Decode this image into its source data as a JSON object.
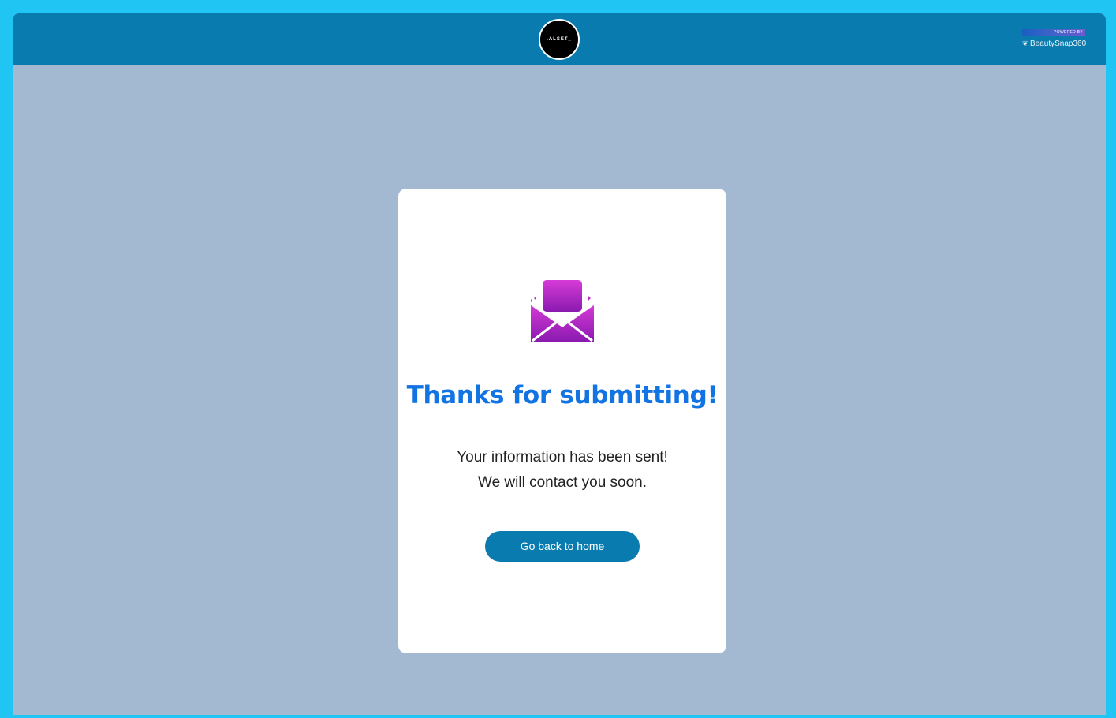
{
  "header": {
    "logo_text": ".ALSET_",
    "powered_by_label": "POWERED BY",
    "powered_by_brand": "BeautySnap360"
  },
  "confirmation": {
    "icon": "envelope-open-icon",
    "title": "Thanks for submitting!",
    "line1": "Your information has been sent!",
    "line2": "We will contact you soon.",
    "button_label": "Go back to home"
  },
  "colors": {
    "frame": "#21c5f3",
    "header_bg": "#0a7bae",
    "page_bg": "#a3b8d1",
    "title": "#1273e3",
    "button_bg": "#0a7bae",
    "icon_gradient_start": "#d63bd6",
    "icon_gradient_end": "#8a1ab0"
  }
}
